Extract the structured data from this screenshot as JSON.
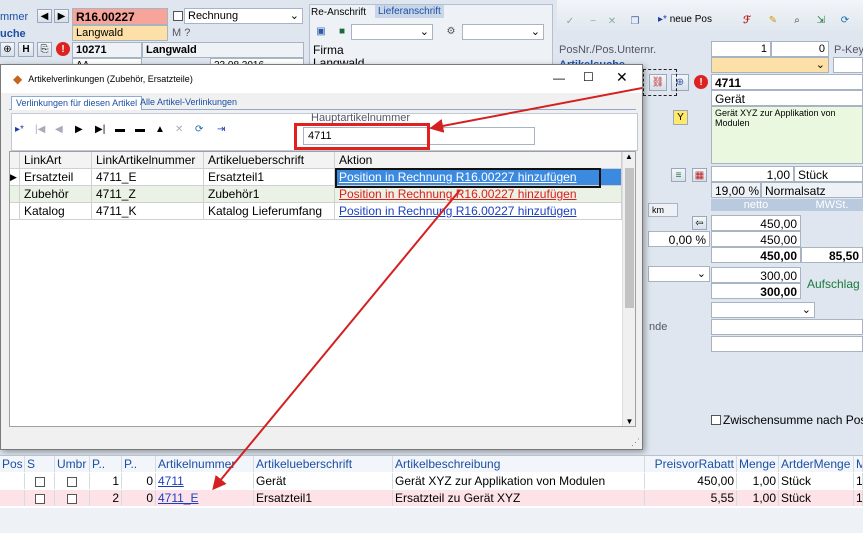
{
  "left": {
    "lbl_mmer": "mmer",
    "lbl_uche": "uche",
    "invoice_no": "R16.00227",
    "customer_name": "Langwald",
    "customer_no": "10271",
    "customer_name2": "Langwald",
    "doc_type": "Rechnung",
    "m_label": "M ?",
    "aa_value": "AA",
    "date_value": "23.08.2016",
    "addr_tab": "Re-Anschrift",
    "delivery_tab": "Lieferanschrift",
    "firma": "Firma",
    "langwald": "Langwald"
  },
  "toolbar": {
    "new_pos_label": "neue Pos"
  },
  "right": {
    "posnr_label": "PosNr./Pos.Unternr.",
    "pkey_label": "P-Key",
    "artikelsuche_label": "Artikelsuche",
    "posnr_value": "1",
    "pos_sub_value": "0",
    "art_no": "4711",
    "art_name": "Gerät",
    "art_desc": "Gerät XYZ zur Applikation von Modulen",
    "qty": "1,00",
    "unit": "Stück",
    "vat_pct": "19,00 %",
    "vat_name": "Normalsatz",
    "km": "km",
    "netto_header": "netto",
    "mwst_header": "MWSt.",
    "netto1": "450,00",
    "netto2": "450,00",
    "netto3": "450,00",
    "mwst_value": "85,50",
    "discount": "0,00 %",
    "ek1": "300,00",
    "ek2": "300,00",
    "aufschlag": "Aufschlag",
    "ende_label": "nde",
    "zwischensumme": "Zwischensumme nach Posit"
  },
  "dialog": {
    "title": "Artikelverlinkungen (Zubehör, Ersatzteile)",
    "tabs": [
      "Verlinkungen für diesen Artikel",
      "Alle Artikel-Verlinkungen"
    ],
    "haupt_label": "Hauptartikelnummer",
    "haupt_value": "4711",
    "columns": [
      "LinkArt",
      "LinkArtikelnummer",
      "Artikelueberschrift",
      "Aktion"
    ],
    "rows": [
      {
        "linkart": "Ersatzteil",
        "nr": "4711_E",
        "title": "Ersatzteil1",
        "aktion": "Position in Rechnung R16.00227 hinzufügen"
      },
      {
        "linkart": "Zubehör",
        "nr": "4711_Z",
        "title": "Zubehör1",
        "aktion": "Position in Rechnung R16.00227 hinzufügen"
      },
      {
        "linkart": "Katalog",
        "nr": "4711_K",
        "title": "Katalog Lieferumfang",
        "aktion": "Position in Rechnung R16.00227 hinzufügen"
      }
    ]
  },
  "bottom": {
    "columns": [
      "Pos",
      "S",
      "Umbr",
      "P..",
      "P..",
      "Artikelnummer",
      "Artikelueberschrift",
      "Artikelbeschreibung",
      "PreisvorRabatt",
      "Menge",
      "ArtderMenge",
      "M"
    ],
    "rows": [
      {
        "p1": "1",
        "p2": "0",
        "nr": "4711",
        "title": "Gerät",
        "desc": "Gerät XYZ zur Applikation von Modulen",
        "price": "450,00",
        "qty": "1,00",
        "unit": "Stück",
        "m": "1"
      },
      {
        "p1": "2",
        "p2": "0",
        "nr": "4711_E",
        "title": "Ersatzteil1",
        "desc": "Ersatzteil zu Gerät XYZ",
        "price": "5,55",
        "qty": "1,00",
        "unit": "Stück",
        "m": "1"
      }
    ]
  }
}
